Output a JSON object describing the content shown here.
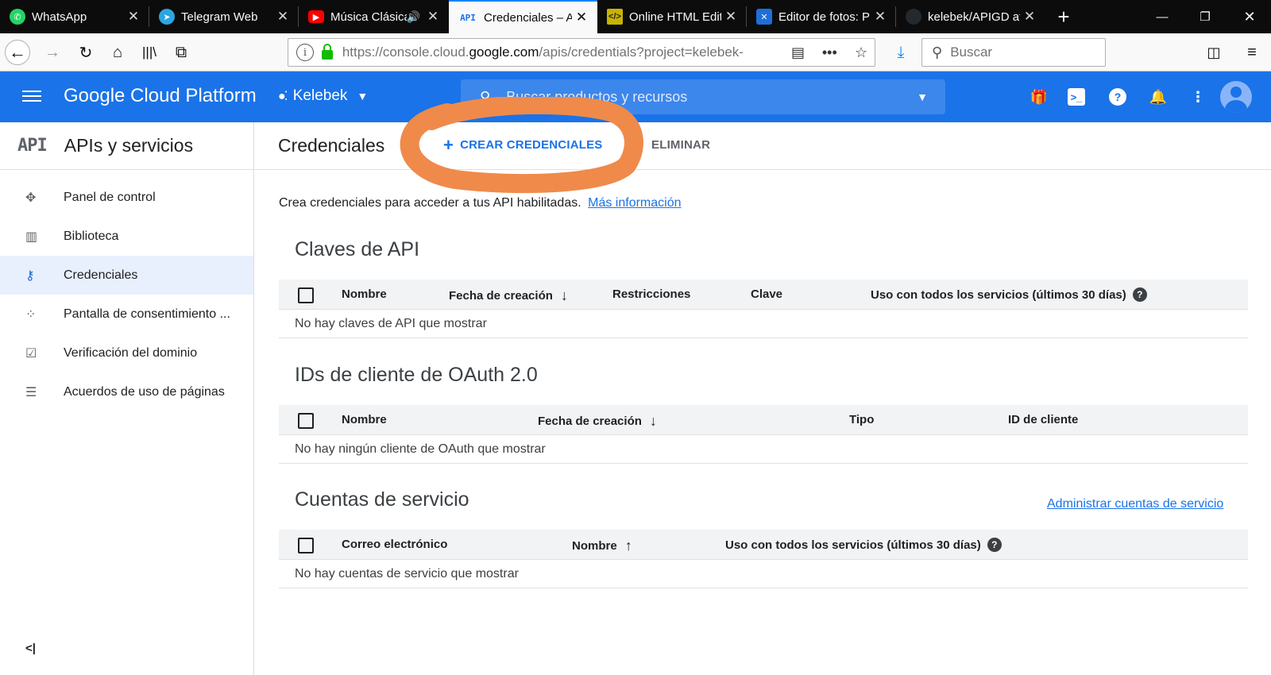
{
  "browser": {
    "tabs": [
      {
        "title": "WhatsApp",
        "icon": "whatsapp-icon",
        "color": "#25d366"
      },
      {
        "title": "Telegram Web",
        "icon": "telegram-icon",
        "color": "#2ca5e0"
      },
      {
        "title": "Música Clásica",
        "icon": "youtube-icon",
        "color": "#ff0000"
      },
      {
        "title": "Credenciales – AP",
        "icon": "api-icon",
        "color": "#1a73e8"
      },
      {
        "title": "Online HTML Edit",
        "icon": "code-editor-icon",
        "color": "#c8b400"
      },
      {
        "title": "Editor de fotos: P",
        "icon": "photo-editor-icon",
        "color": "#1e6fd9"
      },
      {
        "title": "kelebek/APIGD at",
        "icon": "github-icon",
        "color": "#24292e"
      }
    ],
    "active_tab": 3,
    "new_tab": "+",
    "url": {
      "prefix": "https://console.cloud.",
      "domain": "google.com",
      "suffix": "/apis/credentials?project=kelebek-"
    },
    "search_placeholder": "Buscar",
    "accent": "#0a84ff"
  },
  "gcp": {
    "brand": "Google Cloud Platform",
    "project": "Kelebek",
    "search_placeholder": "Buscar productos y recursos",
    "bar_color": "#1a73e8"
  },
  "sidebar": {
    "api_logo": "API",
    "title": "APIs y servicios",
    "items": [
      {
        "label": "Panel de control",
        "icon": "dashboard-icon"
      },
      {
        "label": "Biblioteca",
        "icon": "library-icon"
      },
      {
        "label": "Credenciales",
        "icon": "key-icon"
      },
      {
        "label": "Pantalla de consentimiento ...",
        "icon": "consent-icon"
      },
      {
        "label": "Verificación del dominio",
        "icon": "domain-check-icon"
      },
      {
        "label": "Acuerdos de uso de páginas",
        "icon": "settings-list-icon"
      }
    ],
    "active_item": 2,
    "collapse": "<|"
  },
  "main": {
    "title": "Credenciales",
    "create_label": "CREAR CREDENCIALES",
    "delete_label": "ELIMINAR",
    "intro_text": "Crea credenciales para acceder a tus API habilitadas.",
    "intro_link": "Más información",
    "api_keys": {
      "title": "Claves de API",
      "columns": [
        "Nombre",
        "Fecha de creación",
        "Restricciones",
        "Clave",
        "Uso con todos los servicios (últimos 30 días)"
      ],
      "empty": "No hay claves de API que mostrar"
    },
    "oauth": {
      "title": "IDs de cliente de OAuth 2.0",
      "columns": [
        "Nombre",
        "Fecha de creación",
        "Tipo",
        "ID de cliente"
      ],
      "empty": "No hay ningún cliente de OAuth que mostrar"
    },
    "service_accounts": {
      "title": "Cuentas de servicio",
      "manage_link": "Administrar cuentas de servicio",
      "columns": [
        "Correo electrónico",
        "Nombre",
        "Uso con todos los servicios (últimos 30 días)"
      ],
      "empty": "No hay cuentas de servicio que mostrar"
    },
    "highlight_color": "#ef8a4a"
  }
}
